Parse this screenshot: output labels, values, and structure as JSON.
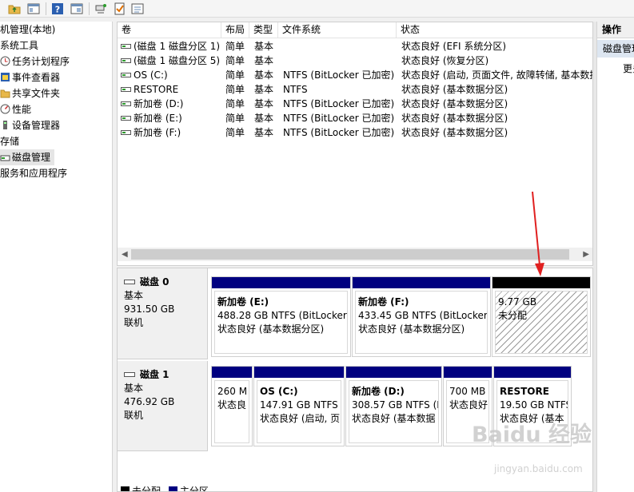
{
  "toolbar": {
    "icons": [
      "folder-up-icon",
      "console-tree-icon",
      "help-icon",
      "properties-icon",
      "connect-icon",
      "check-icon",
      "list-icon"
    ]
  },
  "tree": {
    "items": [
      {
        "label": "机管理(本地)",
        "icon": ""
      },
      {
        "label": "系统工具",
        "icon": ""
      },
      {
        "label": "任务计划程序",
        "icon": "task-scheduler-icon"
      },
      {
        "label": "事件查看器",
        "icon": "event-viewer-icon"
      },
      {
        "label": "共享文件夹",
        "icon": "shared-folder-icon"
      },
      {
        "label": "性能",
        "icon": "performance-icon"
      },
      {
        "label": "设备管理器",
        "icon": "device-manager-icon"
      },
      {
        "label": "存储",
        "icon": ""
      },
      {
        "label": "磁盘管理",
        "icon": "disk-management-icon"
      },
      {
        "label": "服务和应用程序",
        "icon": ""
      }
    ]
  },
  "volumes": {
    "headers": [
      "卷",
      "布局",
      "类型",
      "文件系统",
      "状态"
    ],
    "rows": [
      {
        "name": "(磁盘 1 磁盘分区 1)",
        "layout": "简单",
        "type": "基本",
        "fs": "",
        "status": "状态良好 (EFI 系统分区)"
      },
      {
        "name": "(磁盘 1 磁盘分区 5)",
        "layout": "简单",
        "type": "基本",
        "fs": "",
        "status": "状态良好 (恢复分区)"
      },
      {
        "name": "OS (C:)",
        "layout": "简单",
        "type": "基本",
        "fs": "NTFS (BitLocker 已加密)",
        "status": "状态良好 (启动, 页面文件, 故障转储, 基本数据分区)"
      },
      {
        "name": "RESTORE",
        "layout": "简单",
        "type": "基本",
        "fs": "NTFS",
        "status": "状态良好 (基本数据分区)"
      },
      {
        "name": "新加卷 (D:)",
        "layout": "简单",
        "type": "基本",
        "fs": "NTFS (BitLocker 已加密)",
        "status": "状态良好 (基本数据分区)"
      },
      {
        "name": "新加卷 (E:)",
        "layout": "简单",
        "type": "基本",
        "fs": "NTFS (BitLocker 已加密)",
        "status": "状态良好 (基本数据分区)"
      },
      {
        "name": "新加卷 (F:)",
        "layout": "简单",
        "type": "基本",
        "fs": "NTFS (BitLocker 已加密)",
        "status": "状态良好 (基本数据分区)"
      }
    ]
  },
  "disks": [
    {
      "name": "磁盘 0",
      "type": "基本",
      "size": "931.50 GB",
      "state": "联机",
      "partitions": [
        {
          "name": "新加卷  (E:)",
          "detail": "488.28 GB NTFS (BitLocker",
          "status": "状态良好 (基本数据分区)",
          "unallocated": false
        },
        {
          "name": "新加卷  (F:)",
          "detail": "433.45 GB NTFS (BitLocker",
          "status": "状态良好 (基本数据分区)",
          "unallocated": false
        },
        {
          "name": "",
          "detail": "9.77 GB",
          "status": "未分配",
          "unallocated": true
        }
      ]
    },
    {
      "name": "磁盘 1",
      "type": "基本",
      "size": "476.92 GB",
      "state": "联机",
      "partitions": [
        {
          "name": "",
          "detail": "260 M",
          "status": "状态良",
          "unallocated": false
        },
        {
          "name": "OS  (C:)",
          "detail": "147.91 GB NTFS (",
          "status": "状态良好 (启动, 页",
          "unallocated": false
        },
        {
          "name": "新加卷  (D:)",
          "detail": "308.57 GB NTFS (E",
          "status": "状态良好 (基本数据",
          "unallocated": false
        },
        {
          "name": "",
          "detail": "700 MB",
          "status": "状态良好",
          "unallocated": false
        },
        {
          "name": "RESTORE",
          "detail": "19.50 GB NTFS",
          "status": "状态良好 (基本",
          "unallocated": false
        }
      ]
    }
  ],
  "legend": [
    {
      "label": "未分配",
      "color": "#000000"
    },
    {
      "label": "主分区",
      "color": "#000080"
    }
  ],
  "actions": {
    "header": "操作",
    "selected": "磁盘管理",
    "more": "更多"
  },
  "watermark": {
    "text": "Baidu 经验",
    "sub": "jingyan.baidu.com"
  },
  "annotation_color": "#e02020"
}
